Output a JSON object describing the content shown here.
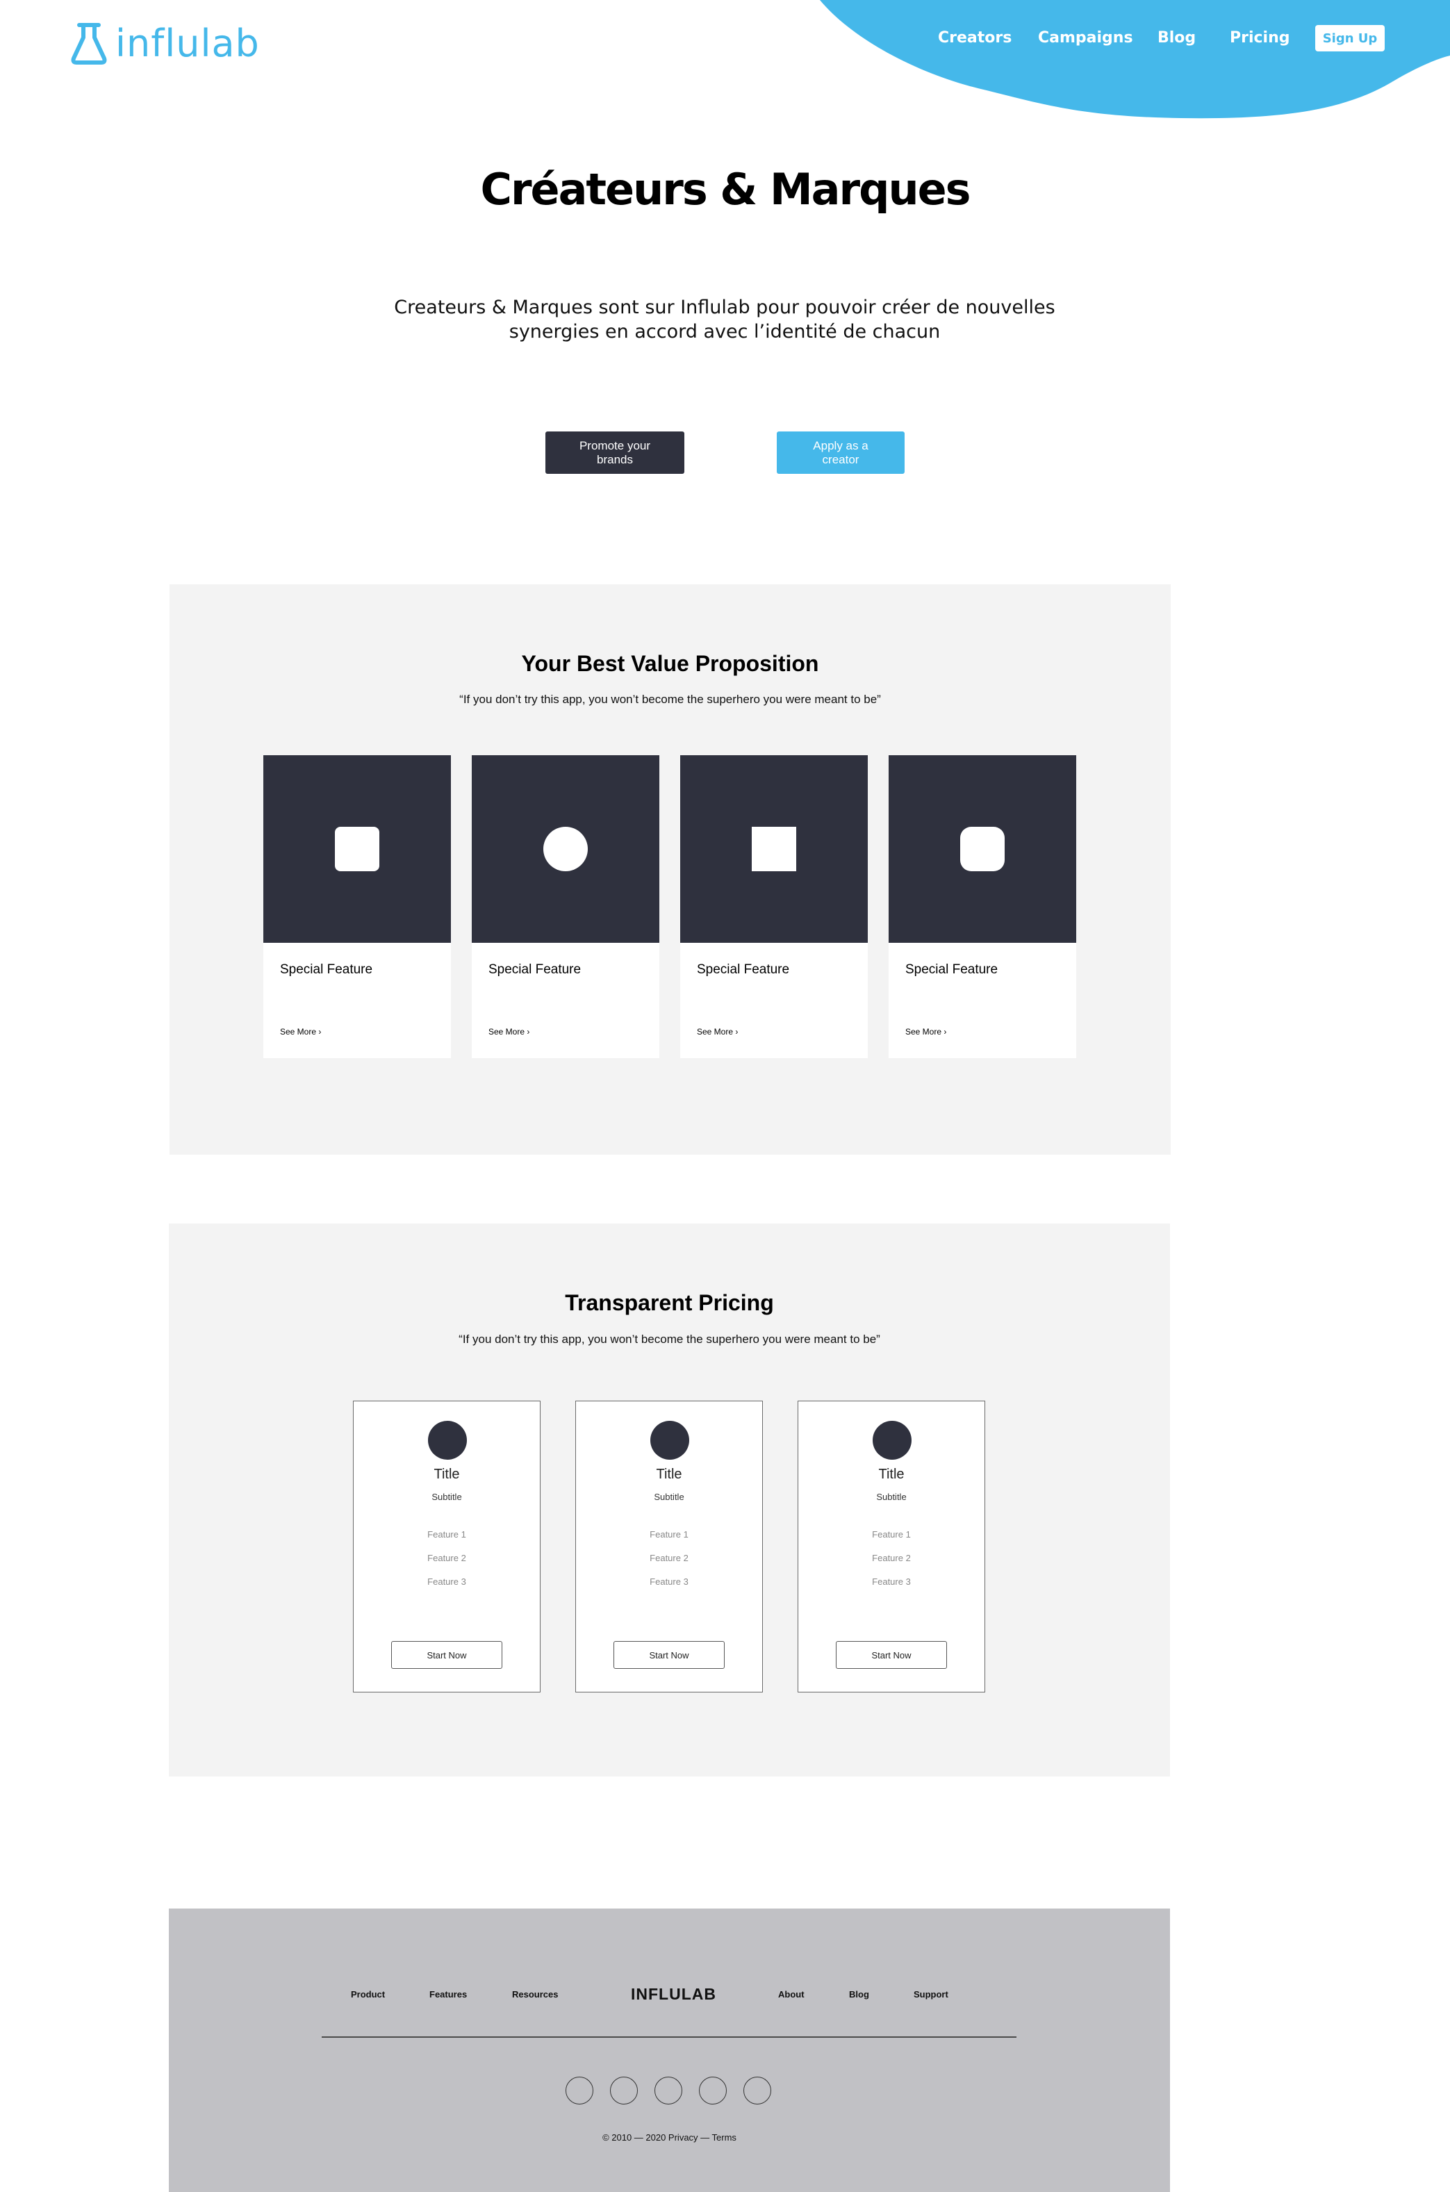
{
  "header": {
    "logo_text": "influlab",
    "nav": [
      "Creators",
      "Campaigns",
      "Blog",
      "Pricing"
    ],
    "signup_label": "Sign Up"
  },
  "hero": {
    "title": "Créateurs & Marques",
    "subtitle": "Createurs & Marques sont sur Influlab pour pouvoir créer de nouvelles synergies en accord avec l’identité de chacun",
    "cta_brands": "Promote your brands",
    "cta_creator": "Apply as a creator"
  },
  "value_section": {
    "title": "Your Best Value Proposition",
    "quote": "“If you don’t try this app, you won’t become the superhero you were meant to be”",
    "cards": [
      {
        "title": "Special Feature",
        "link": "See More ›",
        "icon": "rounded-square-icon"
      },
      {
        "title": "Special Feature",
        "link": "See More ›",
        "icon": "circle-icon"
      },
      {
        "title": "Special Feature",
        "link": "See More ›",
        "icon": "square-icon"
      },
      {
        "title": "Special Feature",
        "link": "See More ›",
        "icon": "rounded-square-icon"
      }
    ]
  },
  "pricing_section": {
    "title": "Transparent Pricing",
    "quote": "“If you don’t try this app, you won’t become the superhero you were meant to be”",
    "plans": [
      {
        "title": "Title",
        "subtitle": "Subtitle",
        "features": [
          "Feature 1",
          "Feature 2",
          "Feature 3"
        ],
        "button": "Start Now"
      },
      {
        "title": "Title",
        "subtitle": "Subtitle",
        "features": [
          "Feature 1",
          "Feature 2",
          "Feature 3"
        ],
        "button": "Start Now"
      },
      {
        "title": "Title",
        "subtitle": "Subtitle",
        "features": [
          "Feature 1",
          "Feature 2",
          "Feature 3"
        ],
        "button": "Start Now"
      }
    ]
  },
  "footer": {
    "links_left": [
      "Product",
      "Features",
      "Resources"
    ],
    "brand": "INFLULAB",
    "links_right": [
      "About",
      "Blog",
      "Support"
    ],
    "copyright": "© 2010 — 2020    Privacy — Terms"
  },
  "colors": {
    "accent": "#45b8ea",
    "dark": "#2f313e",
    "section_bg": "#f3f3f3",
    "footer_bg": "#c1c1c5"
  }
}
